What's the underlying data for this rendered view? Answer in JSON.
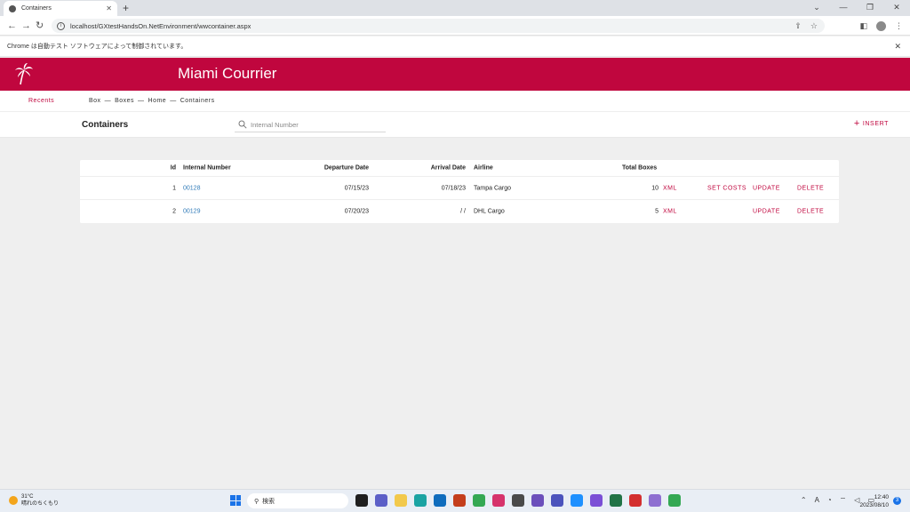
{
  "browser": {
    "tab_title": "Containers",
    "url": "localhost/GXtestHandsOn.NetEnvironment/wwcontainer.aspx",
    "automation_notice": "Chrome は自動テスト ソフトウェアによって制御されています。"
  },
  "app": {
    "title": "Miami Courrier",
    "brand_color": "#c0063e"
  },
  "nav": {
    "recents": "Recents",
    "breadcrumb": [
      "Box",
      "—",
      "Boxes",
      "—",
      "Home",
      "—",
      "Containers"
    ]
  },
  "page": {
    "title": "Containers",
    "search_placeholder": "Internal Number",
    "insert_label": "INSERT"
  },
  "grid": {
    "headers": {
      "id": "Id",
      "internal_number": "Internal Number",
      "departure_date": "Departure Date",
      "arrival_date": "Arrival Date",
      "airline": "Airline",
      "total_boxes": "Total Boxes"
    },
    "rows": [
      {
        "id": "1",
        "internal_number": "00128",
        "departure_date": "07/15/23",
        "arrival_date": "07/18/23",
        "airline": "Tampa Cargo",
        "total_boxes": "10",
        "xml": "XML",
        "set_costs": "SET COSTS",
        "update": "UPDATE",
        "delete": "DELETE"
      },
      {
        "id": "2",
        "internal_number": "00129",
        "departure_date": "07/20/23",
        "arrival_date": "/ /",
        "airline": "DHL Cargo",
        "total_boxes": "5",
        "xml": "XML",
        "update": "UPDATE",
        "delete": "DELETE"
      }
    ]
  },
  "taskbar": {
    "temperature": "31°C",
    "weather_text": "晴れのちくもり",
    "search_label": "検索",
    "time": "12:40",
    "date": "2023/08/10",
    "notification_count": "3"
  }
}
